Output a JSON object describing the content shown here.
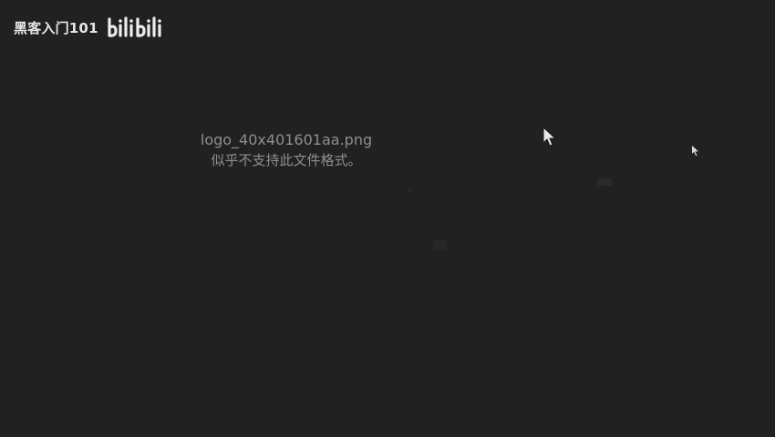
{
  "watermark": {
    "text": "黑客入门101",
    "logo": "bilibili"
  },
  "viewer": {
    "filename": "logo_40x401601aa.png",
    "error_message": "似乎不支持此文件格式。"
  },
  "colors": {
    "background": "#212121",
    "message_text": "#8f8f8f",
    "watermark_text": "#e6e6e6"
  }
}
